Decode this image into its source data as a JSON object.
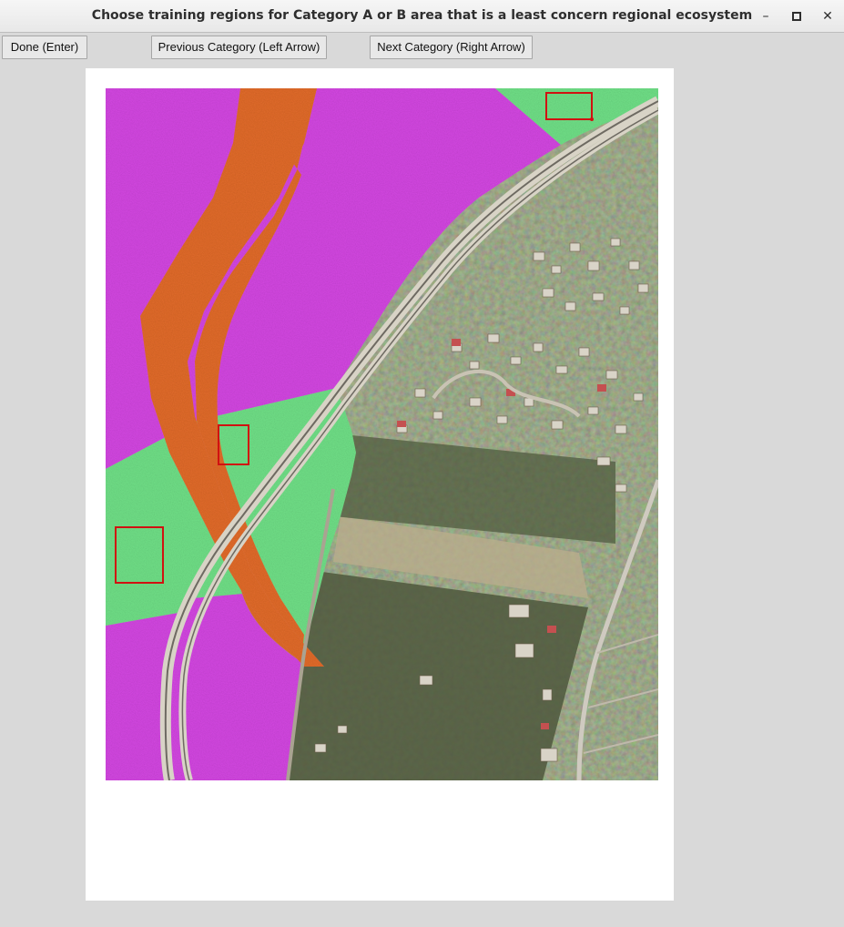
{
  "window": {
    "title": "Choose training regions for Category A or B area that is a least concern regional ecosystem",
    "controls": {
      "minimize_glyph": "–",
      "maximize_glyph": "□",
      "close_glyph": "✕"
    }
  },
  "toolbar": {
    "done_label": "Done (Enter)",
    "previous_label": "Previous Category (Left Arrow)",
    "next_label": "Next Category (Right Arrow)"
  },
  "map": {
    "colors": {
      "magenta_region": "#d246e0",
      "orange_corridor": "#e06a2a",
      "green_region": "#6fde86",
      "selection_box": "#d11111",
      "suburb_base": "#8f8a70",
      "forest": "#4e5a3e",
      "road": "#cfcac0"
    },
    "selection_boxes": 3
  }
}
